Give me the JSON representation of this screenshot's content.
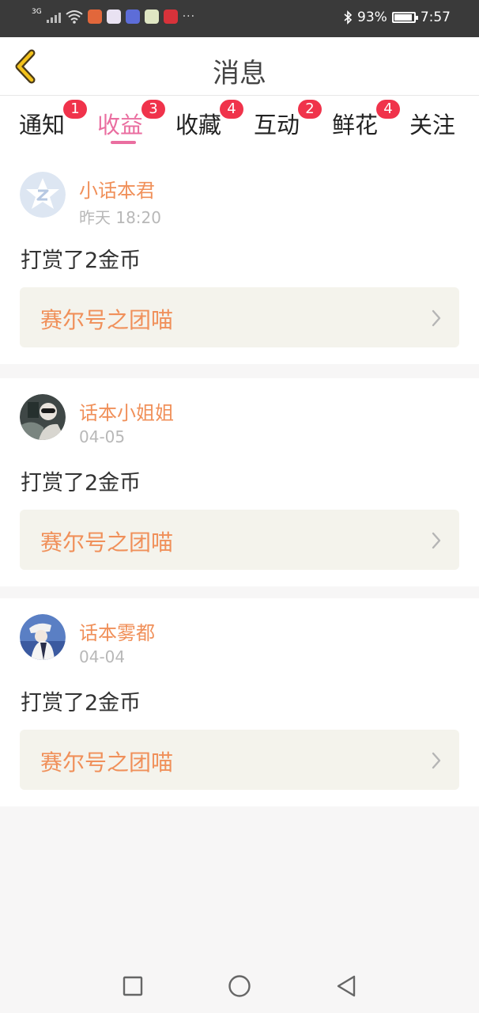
{
  "status_bar": {
    "network": "3G",
    "battery": "93%",
    "battery_level": 0.93,
    "time": "7:57",
    "more": "···",
    "icons": [
      "signal-icon",
      "wifi-icon",
      "app-icon",
      "app-icon",
      "app-icon",
      "app-icon",
      "app-icon",
      "bluetooth-icon",
      "battery-icon"
    ]
  },
  "header": {
    "title": "消息",
    "back_icon": "chevron-left-icon"
  },
  "tabs": [
    {
      "label": "通知",
      "badge": "1"
    },
    {
      "label": "收益",
      "badge": "3",
      "active": true
    },
    {
      "label": "收藏",
      "badge": "4"
    },
    {
      "label": "互动",
      "badge": "2"
    },
    {
      "label": "鲜花",
      "badge": "4"
    },
    {
      "label": "关注",
      "badge": ""
    }
  ],
  "messages": [
    {
      "name": "小话本君",
      "time": "昨天 18:20",
      "text": "打赏了2金币",
      "link": "赛尔号之团喵"
    },
    {
      "name": "话本小姐姐",
      "time": "04-05",
      "text": "打赏了2金币",
      "link": "赛尔号之团喵"
    },
    {
      "name": "话本雾都",
      "time": "04-04",
      "text": "打赏了2金币",
      "link": "赛尔号之团喵"
    }
  ],
  "bottom_nav": [
    "recent-apps-icon",
    "home-icon",
    "back-icon"
  ],
  "colors": {
    "accent": "#ea6ea0",
    "badge": "#f0334b",
    "name": "#f0905a",
    "link_bg": "#f4f3ec"
  }
}
